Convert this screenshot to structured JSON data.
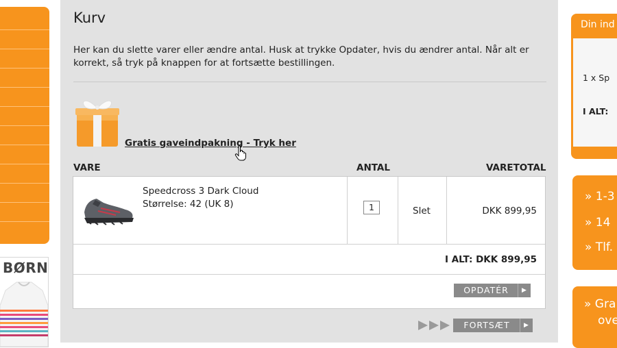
{
  "page": {
    "title": "Kurv",
    "intro": "Her kan du slette varer eller ændre antal. Husk at trykke Opdater, hvis du ændrer antal. Når alt er korrekt, så tryk på knappen for at fortsætte bestillingen."
  },
  "gift_wrap": {
    "link_text": "Gratis gaveindpakning - Tryk her",
    "icon": "gift-icon"
  },
  "table": {
    "headers": {
      "item": "VARE",
      "quantity": "ANTAL",
      "total": "VARETOTAL"
    },
    "items": [
      {
        "name": "Speedcross 3 Dark Cloud",
        "size": "Størrelse: 42 (UK 8)",
        "quantity": "1",
        "delete_label": "Slet",
        "line_total": "DKK 899,95"
      }
    ],
    "grand_total": "I ALT: DKK 899,95"
  },
  "buttons": {
    "update": "OPDATÉR",
    "continue": "FORTSÆT"
  },
  "left": {
    "banner_title": "BØRN"
  },
  "right": {
    "basket_title": "Din ind",
    "basket_line": "1 x  Sp",
    "basket_total": "I ALT:",
    "usp": [
      "» 1-3",
      "» 14",
      "» Tlf."
    ],
    "promo": [
      "» Gra",
      "ove"
    ]
  },
  "colors": {
    "accent": "#f7941d",
    "panel": "#e2e2e2",
    "button": "#8a8a8a"
  }
}
